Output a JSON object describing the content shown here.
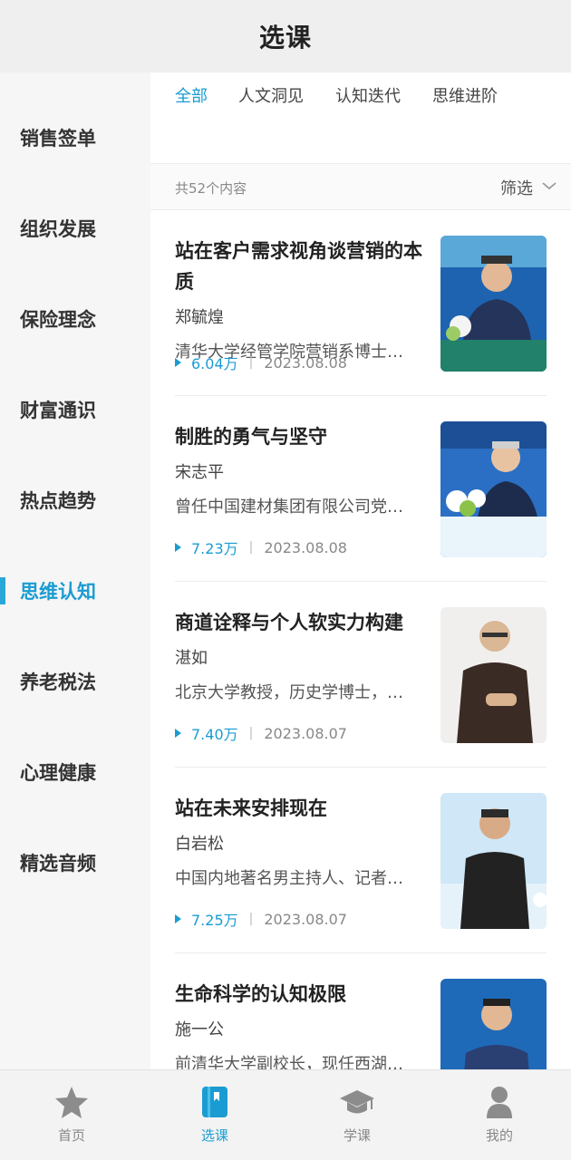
{
  "header": {
    "title": "选课"
  },
  "sidebar": {
    "items": [
      {
        "label": "销售签单",
        "active": false
      },
      {
        "label": "组织发展",
        "active": false
      },
      {
        "label": "保险理念",
        "active": false
      },
      {
        "label": "财富通识",
        "active": false
      },
      {
        "label": "热点趋势",
        "active": false
      },
      {
        "label": "思维认知",
        "active": true
      },
      {
        "label": "养老税法",
        "active": false
      },
      {
        "label": "心理健康",
        "active": false
      },
      {
        "label": "精选音频",
        "active": false
      }
    ]
  },
  "tabs": [
    {
      "label": "全部",
      "active": true
    },
    {
      "label": "人文洞见",
      "active": false
    },
    {
      "label": "认知迭代",
      "active": false
    },
    {
      "label": "思维进阶",
      "active": false
    }
  ],
  "filter": {
    "count_label": "共52个内容",
    "filter_label": "筛选"
  },
  "courses": [
    {
      "title": "站在客户需求视角谈营销的本质",
      "author": "郑毓煌",
      "desc": "清华大学经管学院营销系博士…",
      "views": "6.04万",
      "date": "2023.08.08"
    },
    {
      "title": "制胜的勇气与坚守",
      "author": "宋志平",
      "desc": "曾任中国建材集团有限公司党…",
      "views": "7.23万",
      "date": "2023.08.08"
    },
    {
      "title": "商道诠释与个人软实力构建",
      "author": "湛如",
      "desc": "北京大学教授，历史学博士，…",
      "views": "7.40万",
      "date": "2023.08.07"
    },
    {
      "title": "站在未来安排现在",
      "author": "白岩松",
      "desc": "中国内地著名男主持人、记者…",
      "views": "7.25万",
      "date": "2023.08.07"
    },
    {
      "title": "生命科学的认知极限",
      "author": "施一公",
      "desc": "前清华大学副校长，现任西湖…",
      "views": "",
      "date": ""
    }
  ],
  "tabbar": [
    {
      "label": "首页",
      "icon": "star-icon",
      "active": false
    },
    {
      "label": "选课",
      "icon": "book-icon",
      "active": true
    },
    {
      "label": "学课",
      "icon": "graduation-cap-icon",
      "active": false
    },
    {
      "label": "我的",
      "icon": "person-icon",
      "active": false
    }
  ],
  "colors": {
    "accent": "#1a9cd2",
    "header_bg": "#efefef",
    "sidebar_bg": "#f6f6f6"
  }
}
